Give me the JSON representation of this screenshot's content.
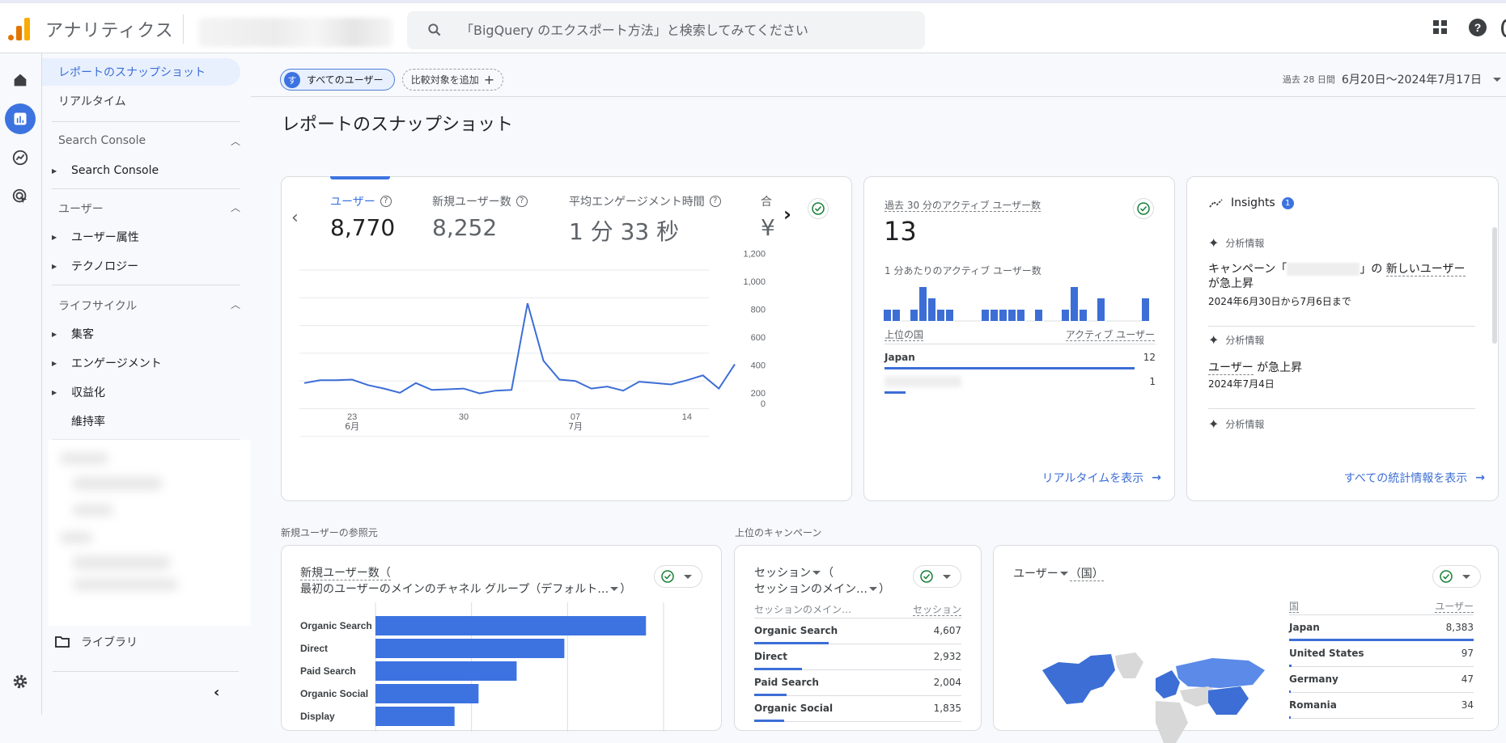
{
  "app": {
    "title": "アナリティクス",
    "search_placeholder": "「BigQuery のエクスポート方法」と検索してみてください",
    "icons": [
      "analytics-logo",
      "search-icon",
      "apps-grid-icon",
      "help-icon"
    ]
  },
  "rail": {
    "items": [
      "home-icon",
      "reports-icon",
      "explore-icon",
      "advertising-icon"
    ],
    "settings_icon": "gear-icon"
  },
  "sidenav": {
    "top_items": [
      {
        "label": "レポートのスナップショット",
        "active": true
      },
      {
        "label": "リアルタイム",
        "active": false
      }
    ],
    "groups": [
      {
        "label": "Search Console",
        "expanded": true,
        "children": [
          {
            "label": "Search Console",
            "has_caret": true
          }
        ]
      },
      {
        "label": "ユーザー",
        "expanded": true,
        "children": [
          {
            "label": "ユーザー属性",
            "has_caret": true
          },
          {
            "label": "テクノロジー",
            "has_caret": true
          }
        ]
      },
      {
        "label": "ライフサイクル",
        "expanded": true,
        "children": [
          {
            "label": "集客",
            "has_caret": true
          },
          {
            "label": "エンゲージメント",
            "has_caret": true
          },
          {
            "label": "収益化",
            "has_caret": true
          },
          {
            "label": "維持率",
            "has_caret": false
          }
        ]
      }
    ],
    "library_label": "ライブラリ",
    "collapse_icon": "chevron-left-icon"
  },
  "header": {
    "segment_chip": {
      "avatar_letter": "す",
      "label": "すべてのユーザー"
    },
    "add_comparison": "比較対象を追加",
    "date_small": "過去 28 日間",
    "date_range": "6月20日～2024年7月17日",
    "page_title": "レポートのスナップショット",
    "tools": [
      "customize-report-icon",
      "share-icon",
      "insights-icon",
      "edit-icon"
    ]
  },
  "kpi_card": {
    "metrics": [
      {
        "label": "ユーザー",
        "value": "8,770",
        "active": true
      },
      {
        "label": "新規ユーザー数",
        "value": "8,252",
        "active": false
      },
      {
        "label": "平均エンゲージメント時間",
        "value": "1 分 33 秒",
        "active": false
      },
      {
        "label": "合",
        "value": "¥",
        "active": false
      }
    ]
  },
  "realtime_card": {
    "title": "過去 30 分のアクティブ ユーザー数",
    "value": "13",
    "per_minute_label": "1 分あたりのアクティブ ユーザー数",
    "per_minute_values": [
      1,
      1,
      0,
      1,
      3,
      2,
      1,
      1,
      0,
      0,
      0,
      1,
      1,
      1,
      1,
      1,
      0,
      1,
      0,
      0,
      1,
      3,
      1,
      0,
      2,
      0,
      0,
      0,
      0,
      2
    ],
    "col_country": "上位の国",
    "col_users": "アクティブ ユーザー",
    "rows": [
      {
        "country": "Japan",
        "value": "12",
        "share": 0.923
      },
      {
        "country": "",
        "value": "1",
        "share": 0.077
      }
    ],
    "link": "リアルタイムを表示"
  },
  "insights_card": {
    "title": "Insights",
    "badge": "1",
    "items": [
      {
        "tag": "分析情報",
        "text_pre": "キャンペーン「",
        "text_mid": "」の ",
        "text_link": "新しいユーザー",
        "text_post": "が急上昇",
        "date": "2024年6月30日から7月6日まで"
      },
      {
        "tag": "分析情報",
        "text_link": "ユーザー",
        "text_post": " が急上昇",
        "date": "2024年7月4日"
      },
      {
        "tag": "分析情報"
      }
    ],
    "link": "すべての統計情報を表示"
  },
  "acquisition": {
    "section": "新規ユーザーの参照元",
    "title_line1": "新規ユーザー数（",
    "title_line2": "最初のユーザーのメインのチャネル グループ（デフォルト…",
    "title_close": "）"
  },
  "campaigns": {
    "section": "上位のキャンペーン",
    "title_line1": "セッション",
    "title_paren": "（",
    "title_line2": "セッションのメイン…",
    "title_close": "）",
    "col_dim": "セッションのメイン…",
    "col_metric": "セッション",
    "rows": [
      {
        "name": "Organic Search",
        "value": "4,607",
        "raw": 4607
      },
      {
        "name": "Direct",
        "value": "2,932",
        "raw": 2932
      },
      {
        "name": "Paid Search",
        "value": "2,004",
        "raw": 2004
      },
      {
        "name": "Organic Social",
        "value": "1,835",
        "raw": 1835
      }
    ]
  },
  "countries": {
    "title_metric": "ユーザー",
    "title_dim": "（国）",
    "col_dim": "国",
    "col_metric": "ユーザー",
    "rows": [
      {
        "name": "Japan",
        "value": "8,383",
        "raw": 8383
      },
      {
        "name": "United States",
        "value": "97",
        "raw": 97
      },
      {
        "name": "Germany",
        "value": "47",
        "raw": 47
      },
      {
        "name": "Romania",
        "value": "34",
        "raw": 34
      }
    ]
  },
  "chart_data": [
    {
      "type": "line",
      "title": "ユーザー",
      "x": [
        "06-20",
        "06-21",
        "06-22",
        "06-23",
        "06-24",
        "06-25",
        "06-26",
        "06-27",
        "06-28",
        "06-29",
        "06-30",
        "07-01",
        "07-02",
        "07-03",
        "07-04",
        "07-05",
        "07-06",
        "07-07",
        "07-08",
        "07-09",
        "07-10",
        "07-11",
        "07-12",
        "07-13",
        "07-14",
        "07-15",
        "07-16",
        "07-17"
      ],
      "series": [
        {
          "name": "ユーザー",
          "values": [
            385,
            405,
            405,
            410,
            370,
            345,
            315,
            385,
            335,
            340,
            345,
            310,
            330,
            335,
            960,
            545,
            410,
            400,
            345,
            360,
            330,
            395,
            385,
            375,
            405,
            440,
            345,
            520
          ],
          "color": "#3c6ed6"
        }
      ],
      "x_ticks": [
        {
          "label": "23",
          "sub": "6月",
          "index": 3
        },
        {
          "label": "30",
          "sub": "",
          "index": 10
        },
        {
          "label": "07",
          "sub": "7月",
          "index": 17
        },
        {
          "label": "14",
          "sub": "",
          "index": 24
        }
      ],
      "y_ticks": [
        "0",
        "200",
        "400",
        "600",
        "800",
        "1,000",
        "1,200"
      ],
      "ylim": [
        0,
        1200
      ],
      "grid": true,
      "legend": "none"
    },
    {
      "type": "bar",
      "orientation": "horizontal",
      "title": "新規ユーザー数（最初のユーザーのメインのチャネル グループ（デフォルト…））",
      "categories": [
        "Organic Search",
        "Direct",
        "Paid Search",
        "Organic Social",
        "Display"
      ],
      "values": [
        4225,
        2950,
        2205,
        1610,
        1235
      ],
      "xlim": [
        0,
        4500
      ],
      "grid": true,
      "color": "#3c73e0"
    }
  ]
}
